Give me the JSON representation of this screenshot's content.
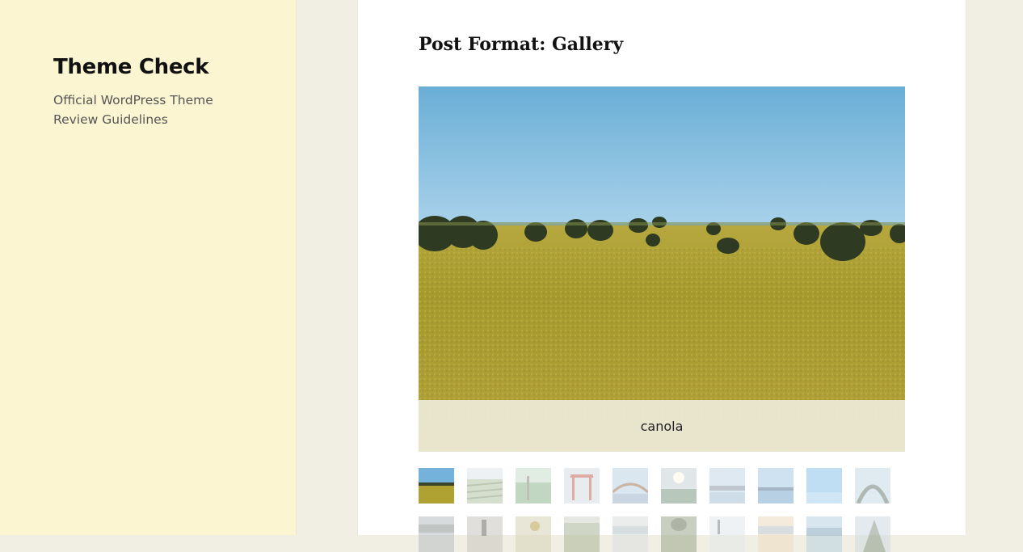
{
  "site": {
    "title": "Theme Check",
    "description": "Official WordPress Theme Review Guidelines"
  },
  "post": {
    "title": "Post Format: Gallery"
  },
  "gallery": {
    "active_caption": "canola",
    "row1": [
      "canola",
      "field-rows",
      "green-field",
      "pier-frame",
      "bridge",
      "sun-lake",
      "bridge-snow",
      "dam-blue",
      "sky-blue",
      "tree-arch"
    ],
    "row2": [
      "grey-sky",
      "lamp",
      "flowers",
      "vines",
      "beach",
      "trees",
      "pole",
      "horizon",
      "sea",
      "rocks"
    ]
  }
}
